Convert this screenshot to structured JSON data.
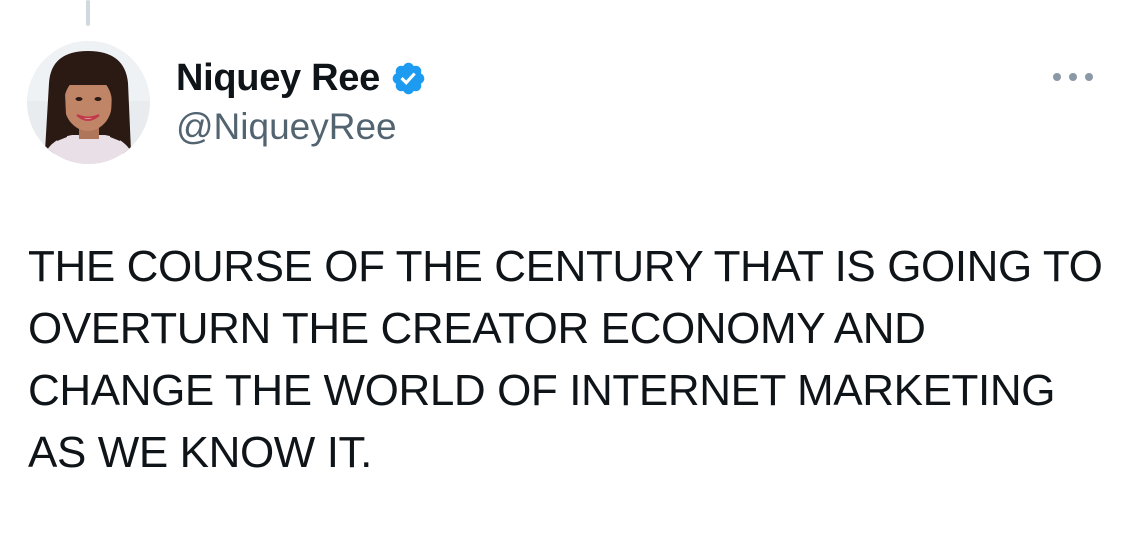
{
  "tweet": {
    "author": {
      "display_name": "Niquey Ree",
      "handle": "@NiqueyRee",
      "verified": true
    },
    "text": "THE COURSE OF THE CENTURY THAT IS GOING TO OVERTURN THE CREATOR ECONOMY AND CHANGE THE WORLD OF INTERNET MARKETING AS WE KNOW IT."
  },
  "colors": {
    "verified_badge": "#1d9bf0",
    "secondary_text": "#536471",
    "primary_text": "#0f1419",
    "thread_line": "#cfd9de"
  },
  "icons": {
    "verified": "verified-badge-icon",
    "more": "more-options-icon"
  }
}
